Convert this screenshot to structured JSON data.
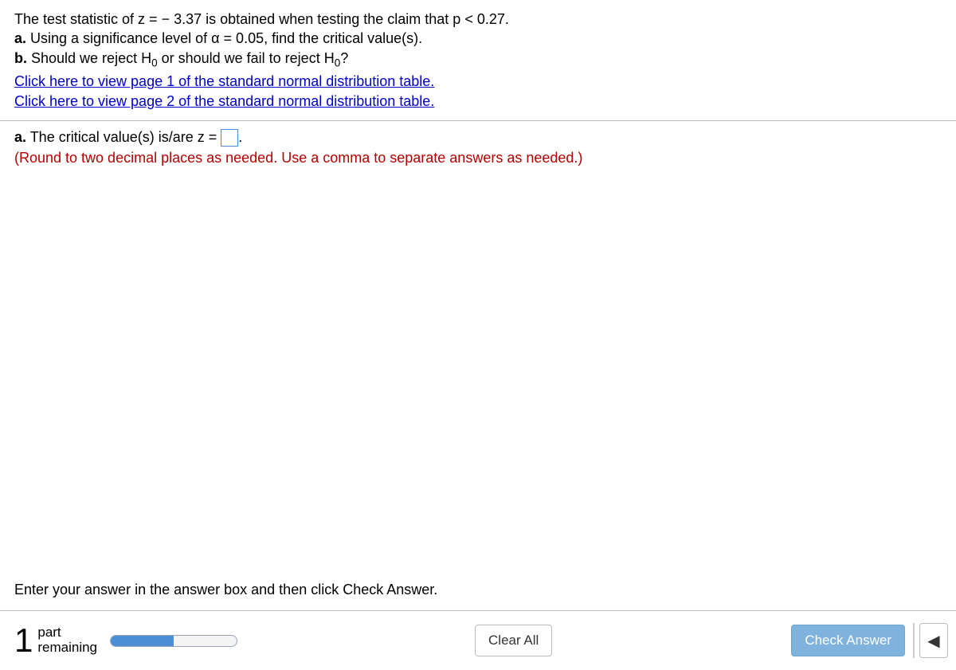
{
  "question": {
    "intro_pre": "The test statistic of z = ",
    "intro_val": " − 3.37",
    "intro_post": " is obtained when testing the claim that p < 0.27.",
    "partA_label": "a.",
    "partA_text": " Using a significance level of α = 0.05, find the critical value(s).",
    "partB_label": "b.",
    "partB_pre": " Should we reject H",
    "partB_sub1": "0",
    "partB_mid": " or should we fail to reject H",
    "partB_sub2": "0",
    "partB_end": "?",
    "link1": "Click here to view page 1 of the standard normal distribution table.",
    "link2": "Click here to view page 2 of the standard normal distribution table."
  },
  "answer": {
    "partA_label": "a.",
    "prompt_pre": " The critical value(s) is/are z = ",
    "prompt_post": ".",
    "hint": "(Round to two decimal places as needed. Use a comma to separate answers as needed.)"
  },
  "footer": {
    "enter_hint": "Enter your answer in the answer box and then click Check Answer.",
    "big_number": "1",
    "parts_line1": "part",
    "parts_line2": "remaining",
    "clear_label": "Clear All",
    "check_label": "Check Answer",
    "progress_percent": 50
  }
}
